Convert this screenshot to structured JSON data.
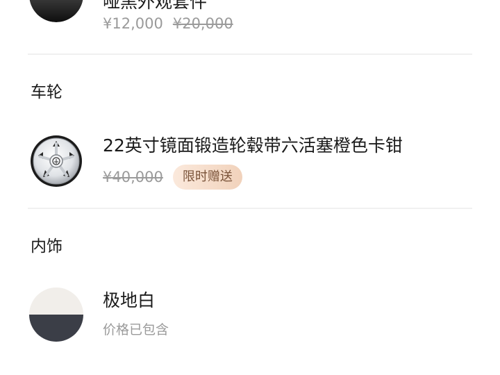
{
  "items": [
    {
      "title": "哑黑外观套件",
      "price": "¥12,000",
      "original_price": "¥20,000"
    },
    {
      "title": "22英寸镜面锻造轮毂带六活塞橙色卡钳",
      "original_price": "¥40,000",
      "badge": "限时赠送"
    },
    {
      "title": "极地白",
      "note": "价格已包含"
    }
  ],
  "sections": {
    "wheels": "车轮",
    "interior": "内饰"
  },
  "colors": {
    "badge_text": "#7a5339",
    "badge_bg_start": "#fbe9dc",
    "badge_bg_end": "#f1d2bb",
    "muted_text": "#9a9a9a"
  },
  "icons": {
    "exterior_kit": "matte-black-swatch-icon",
    "wheel": "wheel-icon",
    "interior": "polar-white-swatch-icon"
  }
}
